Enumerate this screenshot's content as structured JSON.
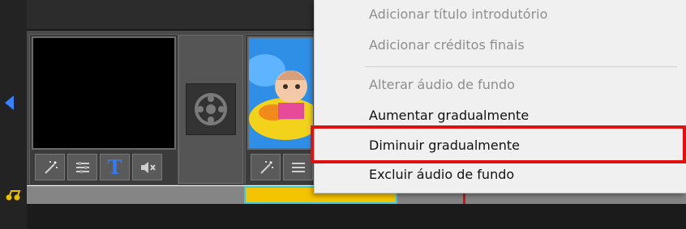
{
  "timeline": {
    "clip1_buttons": [
      {
        "icon": "magic-wand-icon"
      },
      {
        "icon": "adjust-icon"
      },
      {
        "icon": "text-icon",
        "label": "T"
      },
      {
        "icon": "mute-icon"
      }
    ],
    "clip2_buttons": [
      {
        "icon": "magic-wand-icon"
      },
      {
        "icon": "adjust-icon"
      }
    ],
    "colors": {
      "audio_bar": "#f5c400",
      "audio_border": "#3cc8d8",
      "playhead": "#e01010",
      "nav_arrow": "#3a7fff",
      "highlight": "#e01010"
    }
  },
  "context_menu": {
    "items": [
      {
        "label": "Adicionar título introdutório",
        "enabled": false
      },
      {
        "label": "Adicionar créditos finais",
        "enabled": false
      },
      {
        "label": "Alterar áudio de fundo",
        "enabled": false
      },
      {
        "label": "Aumentar gradualmente",
        "enabled": true
      },
      {
        "label": "Diminuir gradualmente",
        "enabled": true,
        "highlighted": true
      },
      {
        "label": "Excluir áudio de fundo",
        "enabled": true
      }
    ]
  }
}
